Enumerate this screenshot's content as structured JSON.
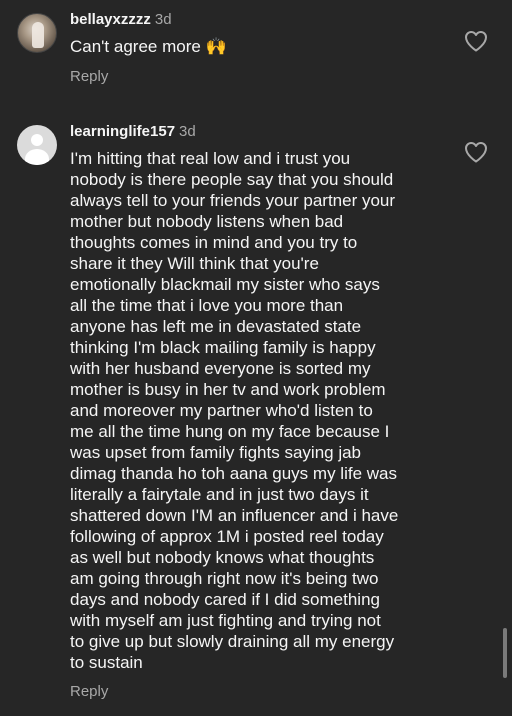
{
  "comments": [
    {
      "username": "bellayxzzzz",
      "time": "3d",
      "text": "Can't agree more 🙌",
      "reply_label": "Reply",
      "avatar": "photo-avatar",
      "like_icon": "heart-outline-icon"
    },
    {
      "username": "learninglife157",
      "time": "3d",
      "text": "I'm hitting that real low and i trust you\nnobody is there people say that you should\nalways tell to your friends your partner your\nmother but nobody listens when bad\nthoughts comes in mind and you try to\nshare it they Will think that you're\nemotionally blackmail my sister who says\nall the time that i love you more than\nanyone has left me in devastated state\nthinking I'm black mailing family is happy\nwith her husband everyone is sorted my\nmother is busy in her tv and work problem\nand moreover my partner who'd listen to\nme all the time hung on my face because I\nwas upset from family fights saying jab\ndimag thanda ho toh aana guys my life was\nliterally a fairytale and in just two days it\nshattered down I'M an influencer and i have\nfollowing of approx 1M i posted reel today\nas well but nobody knows what thoughts\nam going through right now it's being two\ndays and nobody cared if I did something\nwith myself am just fighting and trying not\nto give up but slowly draining all my energy\nto sustain",
      "reply_label": "Reply",
      "avatar": "default-avatar",
      "like_icon": "heart-outline-icon"
    }
  ],
  "colors": {
    "background": "#262626",
    "primary_text": "#f5f5f5",
    "secondary_text": "#a8a8a8"
  }
}
